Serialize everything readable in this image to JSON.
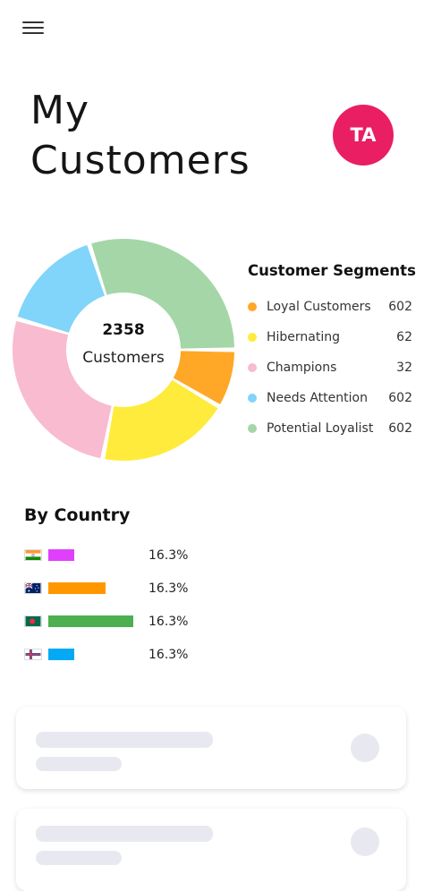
{
  "header": {
    "menu_icon": "hamburger-menu-icon"
  },
  "page": {
    "title_line1": "My",
    "title_line2": "Customers"
  },
  "user": {
    "initials": "TA",
    "avatar_color": "#e91e63"
  },
  "segments": {
    "title": "Customer Segments",
    "total": "2358",
    "total_caption": "Customers",
    "items": [
      {
        "label": "Loyal Customers",
        "count": "602",
        "color": "#ffa726"
      },
      {
        "label": "Hibernating",
        "count": "62",
        "color": "#ffeb3b"
      },
      {
        "label": "Champions",
        "count": "32",
        "color": "#f8bbd0"
      },
      {
        "label": "Needs Attention",
        "count": "602",
        "color": "#81d4fa"
      },
      {
        "label": "Potential Loyalist",
        "count": "602",
        "color": "#a5d6a7"
      }
    ]
  },
  "countries": {
    "title": "By Country",
    "rows": [
      {
        "flag": "india-flag-icon",
        "percent": "16.3%",
        "bar_fraction": 0.31,
        "bar_color": "#e040fb"
      },
      {
        "flag": "australia-flag-icon",
        "percent": "16.3%",
        "bar_fraction": 0.67,
        "bar_color": "#ff9800"
      },
      {
        "flag": "bangladesh-flag-icon",
        "percent": "16.3%",
        "bar_fraction": 1.0,
        "bar_color": "#4caf50"
      },
      {
        "flag": "faroe-islands-flag-icon",
        "percent": "16.3%",
        "bar_fraction": 0.31,
        "bar_color": "#03a9f4"
      }
    ]
  },
  "chart_data": {
    "type": "pie",
    "donut": true,
    "categories": [
      "Loyal Customers",
      "Hibernating",
      "Champions",
      "Needs Attention",
      "Potential Loyalist"
    ],
    "values": [
      602,
      62,
      32,
      602,
      602
    ],
    "visual_fractions": [
      0.085,
      0.195,
      0.265,
      0.155,
      0.3
    ],
    "colors": [
      "#ffa726",
      "#ffeb3b",
      "#f8bbd0",
      "#81d4fa",
      "#a5d6a7"
    ],
    "title": "Customer Segments",
    "center_text": [
      "2358",
      "Customers"
    ],
    "legend": "right"
  }
}
